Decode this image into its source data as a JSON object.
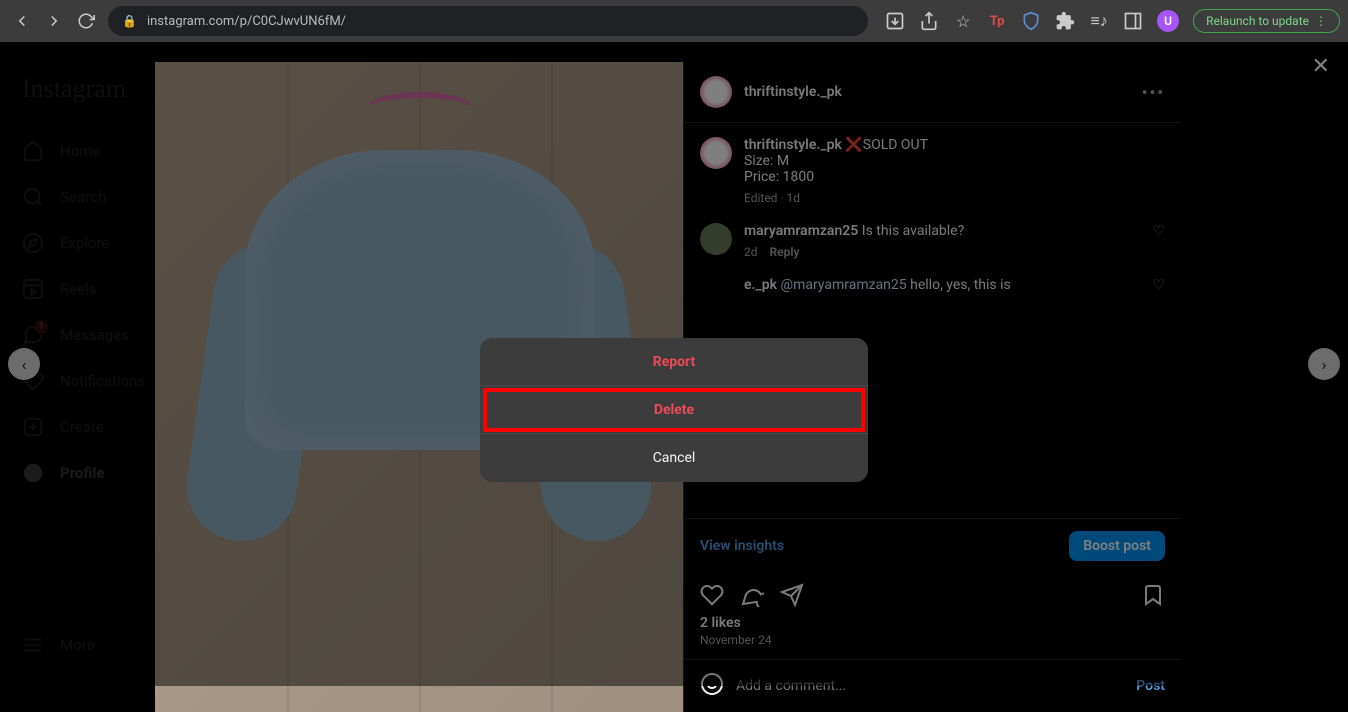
{
  "browser": {
    "url": "instagram.com/p/C0CJwvUN6fM/",
    "profile_initial": "U",
    "relaunch_label": "Relaunch to update"
  },
  "sidebar": {
    "logo": "Instagram",
    "items": [
      {
        "label": "Home"
      },
      {
        "label": "Search"
      },
      {
        "label": "Explore"
      },
      {
        "label": "Reels"
      },
      {
        "label": "Messages",
        "badge": "1"
      },
      {
        "label": "Notifications"
      },
      {
        "label": "Create"
      },
      {
        "label": "Profile"
      }
    ],
    "more_label": "More"
  },
  "post": {
    "author": "thriftinstyle._pk",
    "caption_user": "thriftinstyle._pk",
    "caption_line1": "❌SOLD OUT",
    "caption_line2": "Size: M",
    "caption_line3": "Price: 1800",
    "caption_meta": "Edited · 1d",
    "comment_user": "maryamramzan25",
    "comment_text": "Is this available?",
    "comment_meta_time": "2d",
    "comment_meta_reply": "Reply",
    "reply_user": "e._pk",
    "reply_mention": "@maryamramzan25",
    "reply_text": "hello, yes, this is",
    "insights_label": "View insights",
    "boost_label": "Boost post",
    "likes_text": "2 likes",
    "date_text": "November 24",
    "comment_placeholder": "Add a comment...",
    "post_btn": "Post"
  },
  "dialog": {
    "report": "Report",
    "delete": "Delete",
    "cancel": "Cancel"
  }
}
